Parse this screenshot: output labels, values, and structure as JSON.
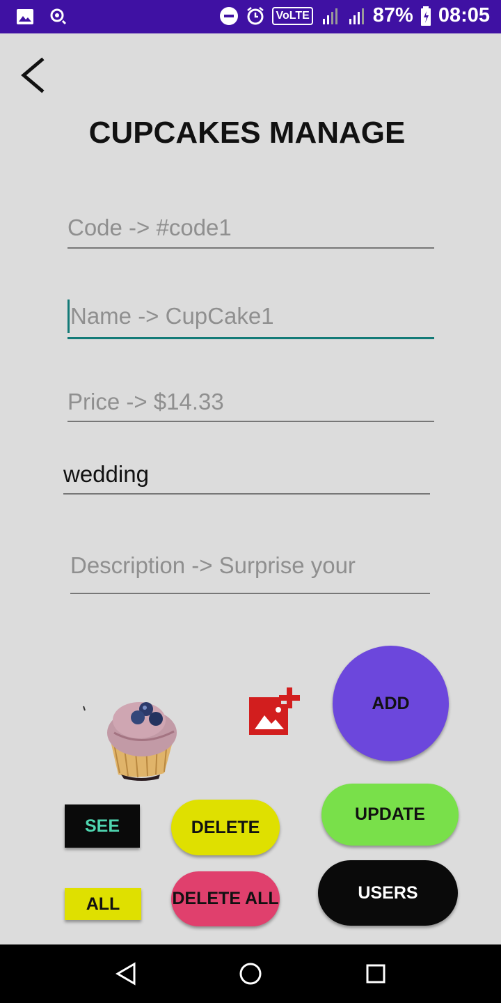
{
  "status_bar": {
    "battery": "87%",
    "time": "08:05",
    "volte": "VoLTE"
  },
  "header": {
    "title": "CUPCAKES MANAGE"
  },
  "form": {
    "code_placeholder": "Code    ->    #code1",
    "name_placeholder": "Name   ->   CupCake1",
    "price_placeholder": "Price    ->    $14.33",
    "category_value": "wedding",
    "description_placeholder": "Description    ->  Surprise your"
  },
  "buttons": {
    "add": "ADD",
    "see": "SEE",
    "delete": "DELETE",
    "update": "UPDATE",
    "all": "ALL",
    "delete_all": "DELETE ALL",
    "users": "USERS"
  },
  "colors": {
    "status_bar": "#3f11a3",
    "add_button": "#6c47dc",
    "see_text": "#4fd6b0",
    "delete_button": "#dfe000",
    "update_button": "#79e04a",
    "all_button": "#dfe000",
    "delete_all_button": "#e0406d",
    "users_button": "#0a0a0a",
    "focus_underline": "#137a77",
    "add_image_icon": "#d21e1e"
  },
  "icons": [
    "image-icon",
    "location-icon",
    "dnd-icon",
    "alarm-icon",
    "signal-icon",
    "battery-icon",
    "back-arrow-icon",
    "add-photo-icon",
    "nav-back-icon",
    "nav-home-icon",
    "nav-recents-icon"
  ]
}
